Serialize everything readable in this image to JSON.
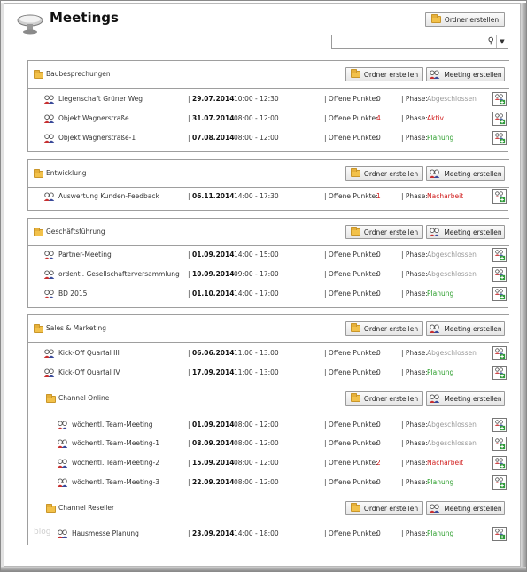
{
  "title": "Meetings",
  "header": {
    "ordner_label": "Ordner erstellen"
  },
  "search": {
    "placeholder": ""
  },
  "labels": {
    "ordner": "Ordner erstellen",
    "meeting": "Meeting erstellen",
    "offene": "| Offene Punkte: ",
    "phase": "| Phase: "
  },
  "watermark": "blog",
  "colors": {
    "red": "#d12020",
    "green": "#2a9d2a",
    "gray": "#9a9a9a",
    "folder": "#f2c14a"
  },
  "sections": [
    {
      "name": "Baubesprechungen",
      "meetings": [
        {
          "name": "Liegenschaft Grüner Weg",
          "date": "29.07.2014",
          "time": "10:00 - 12:30",
          "open": "0",
          "phase": "Abgeschlossen"
        },
        {
          "name": "Objekt Wagnerstraße",
          "date": "31.07.2014",
          "time": "08:00 - 12:00",
          "open": "4",
          "phase": "Aktiv"
        },
        {
          "name": "Objekt Wagnerstraße-1",
          "date": "07.08.2014",
          "time": "08:00 - 12:00",
          "open": "0",
          "phase": "Planung"
        }
      ]
    },
    {
      "name": "Entwicklung",
      "meetings": [
        {
          "name": "Auswertung Kunden-Feedback",
          "date": "06.11.2014",
          "time": "14:00 - 17:30",
          "open": "1",
          "phase": "Nacharbeit"
        }
      ]
    },
    {
      "name": "Geschäftsführung",
      "meetings": [
        {
          "name": "Partner-Meeting",
          "date": "01.09.2014",
          "time": "14:00 - 15:00",
          "open": "0",
          "phase": "Abgeschlossen"
        },
        {
          "name": "ordentl. Gesellschafterversammlung",
          "date": "10.09.2014",
          "time": "09:00 - 17:00",
          "open": "0",
          "phase": "Abgeschlossen"
        },
        {
          "name": "BD 2015",
          "date": "01.10.2014",
          "time": "14:00 - 17:00",
          "open": "0",
          "phase": "Planung"
        }
      ]
    },
    {
      "name": "Sales & Marketing",
      "meetings": [
        {
          "name": "Kick-Off Quartal III",
          "date": "06.06.2014",
          "time": "11:00 - 13:00",
          "open": "0",
          "phase": "Abgeschlossen"
        },
        {
          "name": "Kick-Off Quartal IV",
          "date": "17.09.2014",
          "time": "11:00 - 13:00",
          "open": "0",
          "phase": "Planung"
        }
      ],
      "subfolders": [
        {
          "name": "Channel Online",
          "meetings": [
            {
              "name": "wöchentl. Team-Meeting",
              "date": "01.09.2014",
              "time": "08:00 - 12:00",
              "open": "0",
              "phase": "Abgeschlossen"
            },
            {
              "name": "wöchentl. Team-Meeting-1",
              "date": "08.09.2014",
              "time": "08:00 - 12:00",
              "open": "0",
              "phase": "Abgeschlossen"
            },
            {
              "name": "wöchentl. Team-Meeting-2",
              "date": "15.09.2014",
              "time": "08:00 - 12:00",
              "open": "2",
              "phase": "Nacharbeit"
            },
            {
              "name": "wöchentl. Team-Meeting-3",
              "date": "22.09.2014",
              "time": "08:00 - 12:00",
              "open": "0",
              "phase": "Planung"
            }
          ]
        },
        {
          "name": "Channel Reseller",
          "meetings": [
            {
              "name": "Hausmesse Planung",
              "date": "23.09.2014",
              "time": "14:00 - 18:00",
              "open": "0",
              "phase": "Planung"
            }
          ]
        }
      ]
    }
  ]
}
